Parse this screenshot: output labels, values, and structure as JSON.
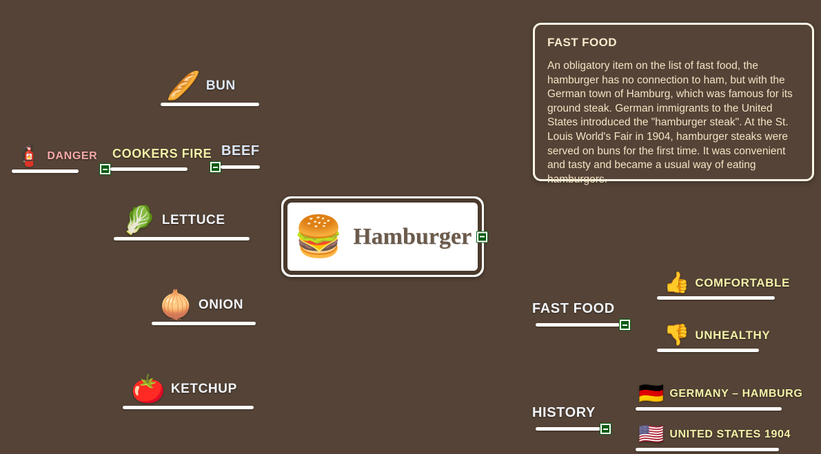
{
  "background_color": "#544336",
  "central": {
    "title": "Hamburger",
    "icon": "hamburger-emoji",
    "icon_glyph": "🍔",
    "collapse_label": "−"
  },
  "info_panel": {
    "heading": "FAST FOOD",
    "body": "An obligatory item on the list of fast food, the hamburger has no connection to ham, but with the German town of Hamburg, which was famous for its ground steak. German immigrants to the United States introduced the \"hamburger steak\". At the St. Louis World's Fair in 1904, hamburger steaks were served on buns for the first time. It was convenient and tasty and became a usual way of eating hamburgers.",
    "heading_color": "#f7e9cd",
    "body_color": "#f3e3c4",
    "border_color": "#fdf6e6"
  },
  "nodes": [
    {
      "id": "bun",
      "label": "BUN",
      "icon": "bread-emoji",
      "icon_glyph": "🥖",
      "color": "#dde7f7",
      "collapsible": false
    },
    {
      "id": "danger",
      "label": "DANGER",
      "icon": "fire-extinguisher-emoji",
      "icon_glyph": "🧯",
      "color": "#f6a8a8",
      "collapsible": false
    },
    {
      "id": "cookers-fire",
      "label": "COOKERS FIRE",
      "icon": "",
      "icon_glyph": "",
      "color": "#f2f0a8",
      "collapsible": true
    },
    {
      "id": "beef",
      "label": "BEEF",
      "icon": "",
      "icon_glyph": "",
      "color": "#dde7f7",
      "collapsible": true
    },
    {
      "id": "lettuce",
      "label": "LETTUCE",
      "icon": "lettuce-emoji",
      "icon_glyph": "🥬",
      "color": "#f2f5fb",
      "collapsible": false
    },
    {
      "id": "onion",
      "label": "ONION",
      "icon": "onion-emoji",
      "icon_glyph": "🧅",
      "color": "#f2f5fb",
      "collapsible": false
    },
    {
      "id": "ketchup",
      "label": "KETCHUP",
      "icon": "tomato-emoji",
      "icon_glyph": "🍅",
      "color": "#f2f5fb",
      "collapsible": false
    },
    {
      "id": "fast-food",
      "label": "FAST FOOD",
      "icon": "",
      "icon_glyph": "",
      "color": "#f2f5fb",
      "collapsible": true
    },
    {
      "id": "comfortable",
      "label": "COMFORTABLE",
      "icon": "thumbs-up-emoji",
      "icon_glyph": "👍",
      "color": "#f2f0a8",
      "collapsible": false
    },
    {
      "id": "unhealthy",
      "label": "UNHEALTHY",
      "icon": "thumbs-down-emoji",
      "icon_glyph": "👎",
      "color": "#f2f0a8",
      "collapsible": false
    },
    {
      "id": "history",
      "label": "HISTORY",
      "icon": "",
      "icon_glyph": "",
      "color": "#f2f5fb",
      "collapsible": true
    },
    {
      "id": "germany-hamburg",
      "label": "GERMANY – HAMBURG",
      "icon": "flag-germany",
      "icon_glyph": "🇩🇪",
      "color": "#f2f0a8",
      "collapsible": false
    },
    {
      "id": "united-states-1904",
      "label": "UNITED STATES 1904",
      "icon": "flag-united-states",
      "icon_glyph": "🇺🇸",
      "color": "#f2f0a8",
      "collapsible": false
    }
  ]
}
